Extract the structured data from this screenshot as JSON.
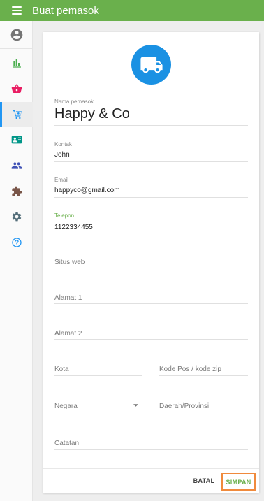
{
  "header": {
    "title": "Buat pemasok",
    "menu_icon": "hamburger-menu-icon",
    "color": "#6ab04c"
  },
  "sidebar": {
    "avatar_icon": "account-circle-icon",
    "items": [
      {
        "icon": "bar-chart-icon",
        "color": "#4caf50",
        "active": false
      },
      {
        "icon": "shopping-basket-icon",
        "color": "#e91e63",
        "active": false
      },
      {
        "icon": "cart-person-icon",
        "color": "#2196f3",
        "active": true
      },
      {
        "icon": "contact-card-icon",
        "color": "#009688",
        "active": false
      },
      {
        "icon": "people-icon",
        "color": "#3f51b5",
        "active": false
      },
      {
        "icon": "puzzle-icon",
        "color": "#795548",
        "active": false
      },
      {
        "icon": "gear-icon",
        "color": "#546e7a",
        "active": false
      },
      {
        "icon": "help-circle-icon",
        "color": "#2196f3",
        "active": false
      }
    ],
    "active_color": "#2196f3"
  },
  "form": {
    "badge_icon": "truck-icon",
    "badge_color": "#1a91e3",
    "name": {
      "label": "Nama pemasok",
      "value": "Happy & Co"
    },
    "contact": {
      "label": "Kontak",
      "value": "John"
    },
    "email": {
      "label": "Email",
      "value": "happyco@gmail.com"
    },
    "phone": {
      "label": "Telepon",
      "value": "1122334455",
      "focused": true,
      "label_color": "#6ab04c"
    },
    "website": {
      "placeholder": "Situs web"
    },
    "address1": {
      "placeholder": "Alamat 1"
    },
    "address2": {
      "placeholder": "Alamat 2"
    },
    "city": {
      "placeholder": "Kota"
    },
    "postal": {
      "placeholder": "Kode Pos / kode zip"
    },
    "country": {
      "placeholder": "Negara",
      "icon": "dropdown-arrow-icon"
    },
    "region": {
      "placeholder": "Daerah/Provinsi"
    },
    "notes": {
      "placeholder": "Catatan"
    }
  },
  "actions": {
    "cancel": "BATAL",
    "save": "SIMPAN",
    "save_color": "#6ab04c",
    "save_highlight": "#f08a3c"
  }
}
